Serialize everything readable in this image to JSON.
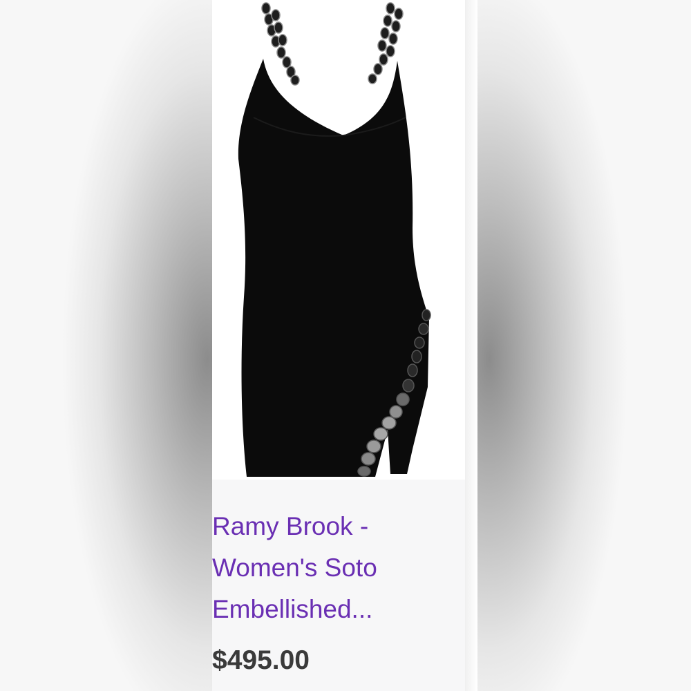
{
  "product": {
    "title": "Ramy Brook - Women's Soto Embellished...",
    "price": "$495.00",
    "image_icon": "black-embellished-mini-dress",
    "title_color": "#6a2fb3",
    "price_color": "#3a3a3a"
  }
}
